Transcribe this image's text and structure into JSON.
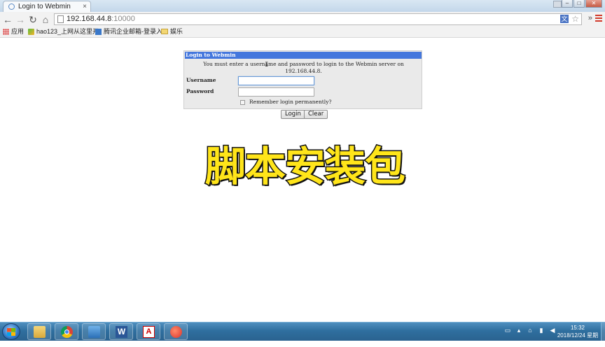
{
  "browser": {
    "tab_title": "Login to Webmin",
    "tab_close": "×",
    "ghost_tab_text": "",
    "window_buttons": {
      "minimize": "–",
      "maximize": "□",
      "close": "✕"
    },
    "url_host": "192.168.44.8",
    "url_port": ":10000",
    "nav": {
      "back": "←",
      "forward": "→",
      "reload": "↻",
      "home": "⌂",
      "star": "☆",
      "translate": "文",
      "extensions": "»"
    },
    "bookmarks": [
      {
        "label": "应用",
        "icon": "apps-grid-icon"
      },
      {
        "label": "hao123_上网从这里开",
        "icon": "hao123-icon"
      },
      {
        "label": "腾讯企业邮箱-登录入",
        "icon": "qq-mail-icon"
      },
      {
        "label": "娱乐",
        "icon": "folder-icon"
      }
    ]
  },
  "login": {
    "title": "Login to Webmin",
    "message": "You must enter a username and password to login to the Webmin server on 192.168.44.8.",
    "username_label": "Username",
    "password_label": "Password",
    "username_value": "",
    "password_value": "",
    "remember_label": "Remember login permanently?",
    "remember_checked": false,
    "login_button": "Login",
    "clear_button": "Clear",
    "title_color": "#4477dd"
  },
  "overlay_caption": "脚本安装包",
  "taskbar": {
    "apps": [
      {
        "name": "explorer",
        "icon": "file-explorer-icon"
      },
      {
        "name": "chrome",
        "icon": "chrome-icon"
      },
      {
        "name": "vmware",
        "icon": "vm-icon"
      },
      {
        "name": "word",
        "icon": "word-icon",
        "glyph": "W"
      },
      {
        "name": "pdf",
        "icon": "pdf-icon",
        "glyph": "A"
      },
      {
        "name": "bird",
        "icon": "app-bird-icon"
      }
    ],
    "clock_time": "15:32",
    "clock_date": "2018/12/24 星期一"
  }
}
